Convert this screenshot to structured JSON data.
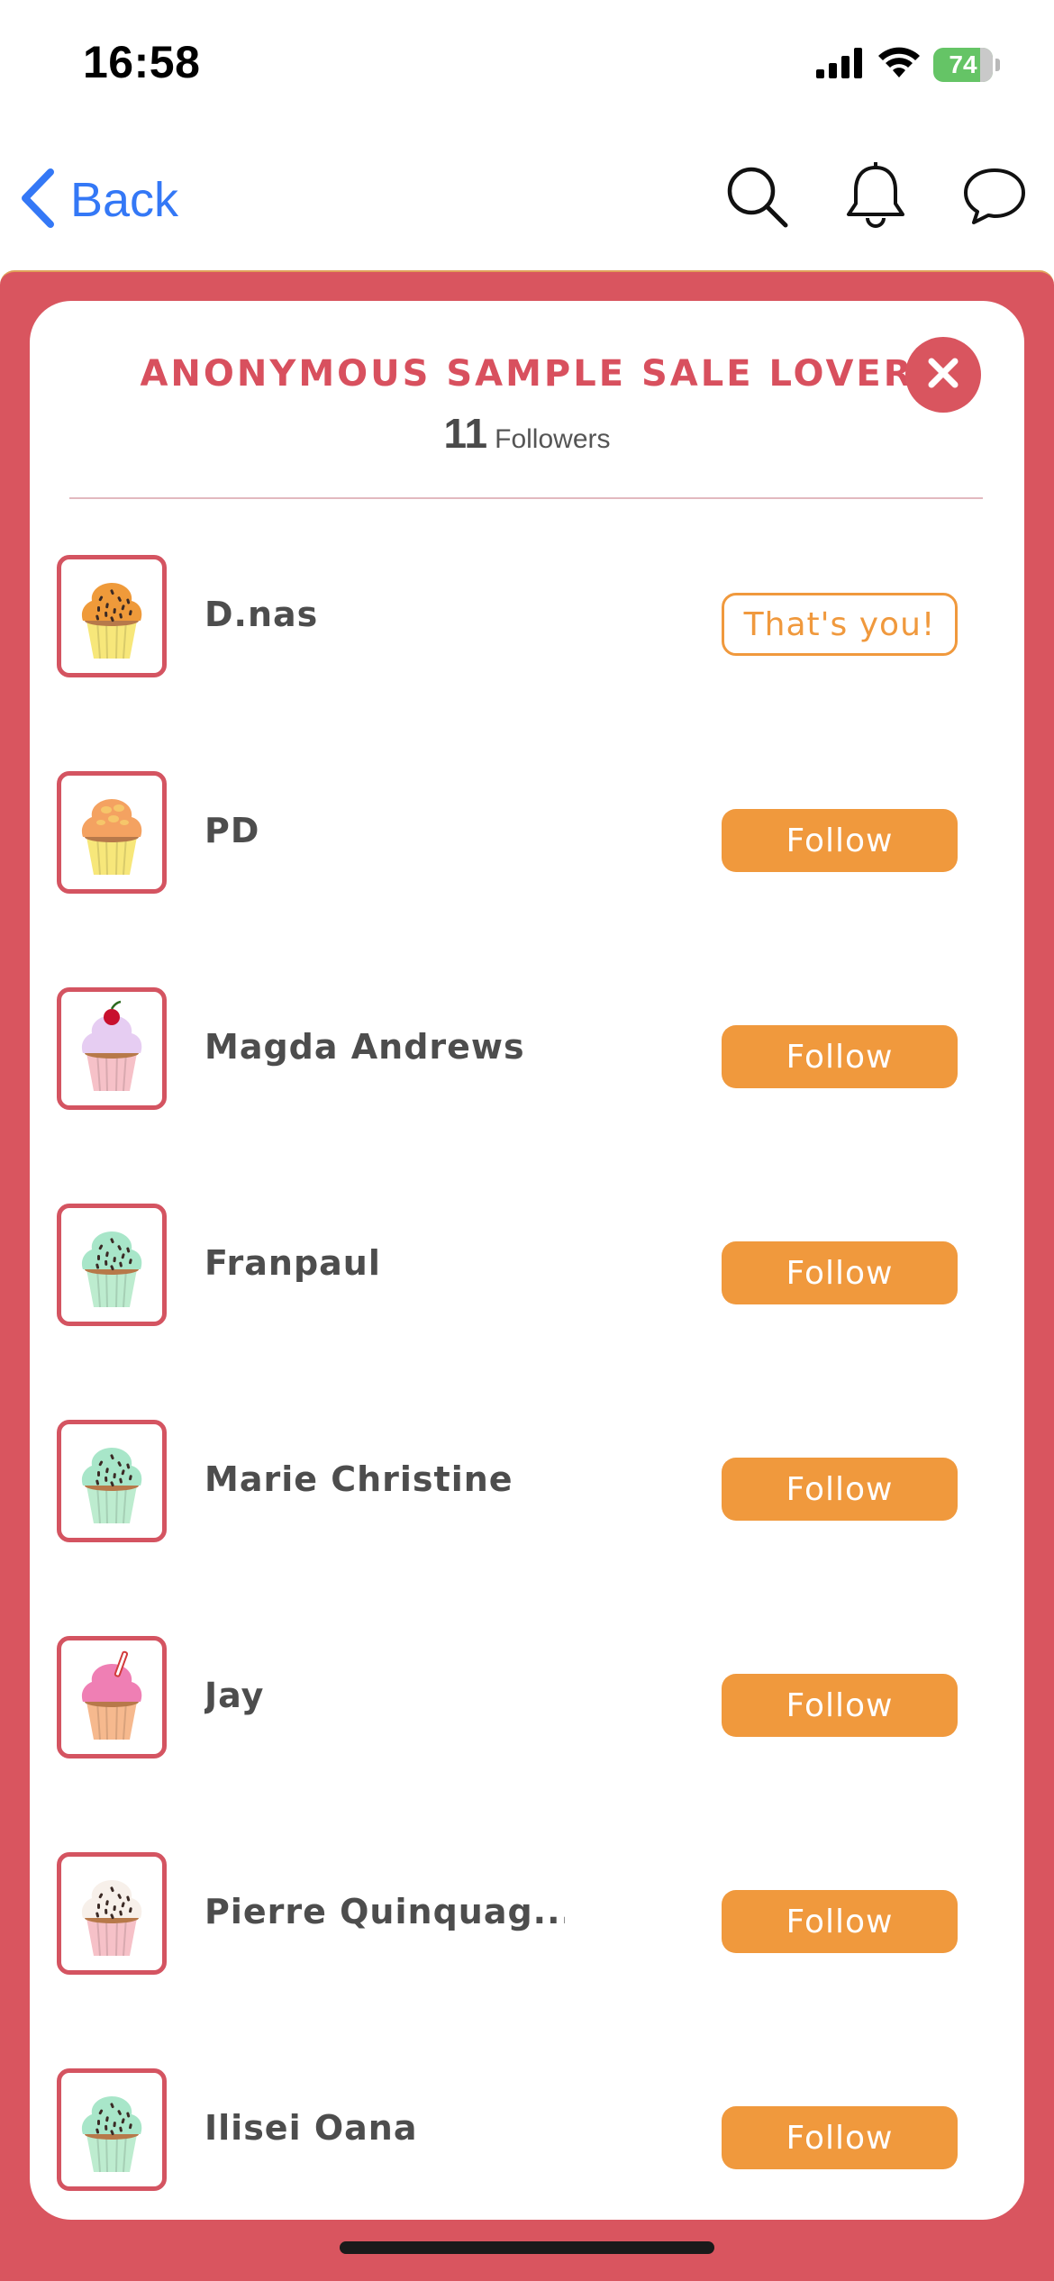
{
  "status_bar": {
    "time": "16:58",
    "battery": "74"
  },
  "nav": {
    "back_label": "Back",
    "icons": [
      "search-icon",
      "bell-icon",
      "chat-bubble-icon"
    ],
    "accent_color": "#3478f6"
  },
  "sheet": {
    "title": "ANONYMOUS SAMPLE SALE LOVER",
    "followers_count": "11",
    "followers_label": "Followers",
    "frame_color": "#d9555f",
    "button_color": "#f0993d"
  },
  "followers": [
    {
      "name": "D.nas",
      "action": "That's you!",
      "style": "outline",
      "cupcake": {
        "frosting": "#ef9a3a",
        "wrapper": "#f7e77a",
        "topping": "sprinkles-dark"
      }
    },
    {
      "name": "PD",
      "action": "Follow",
      "style": "filled",
      "cupcake": {
        "frosting": "#f4a261",
        "wrapper": "#f7e77a",
        "topping": "nuts"
      }
    },
    {
      "name": "Magda Andrews",
      "action": "Follow",
      "style": "filled",
      "cupcake": {
        "frosting": "#e6cdf2",
        "wrapper": "#f6c1c8",
        "topping": "cherry"
      }
    },
    {
      "name": "Franpaul",
      "action": "Follow",
      "style": "filled",
      "cupcake": {
        "frosting": "#a8e6c9",
        "wrapper": "#bdeccf",
        "topping": "sprinkles-dark"
      }
    },
    {
      "name": "Marie Christine",
      "action": "Follow",
      "style": "filled",
      "cupcake": {
        "frosting": "#a8e6c9",
        "wrapper": "#bdeccf",
        "topping": "sprinkles-dark"
      }
    },
    {
      "name": "Jay",
      "action": "Follow",
      "style": "filled",
      "cupcake": {
        "frosting": "#ef7fb4",
        "wrapper": "#f6b98e",
        "topping": "candy-stick"
      }
    },
    {
      "name": "Pierre Quinquag...",
      "action": "Follow",
      "style": "filled",
      "cupcake": {
        "frosting": "#f7f0ea",
        "wrapper": "#f6c1c8",
        "topping": "sprinkles-dark"
      }
    },
    {
      "name": "Ilisei Oana",
      "action": "Follow",
      "style": "filled",
      "cupcake": {
        "frosting": "#a8e6c9",
        "wrapper": "#bdeccf",
        "topping": "sprinkles-dark"
      }
    }
  ]
}
